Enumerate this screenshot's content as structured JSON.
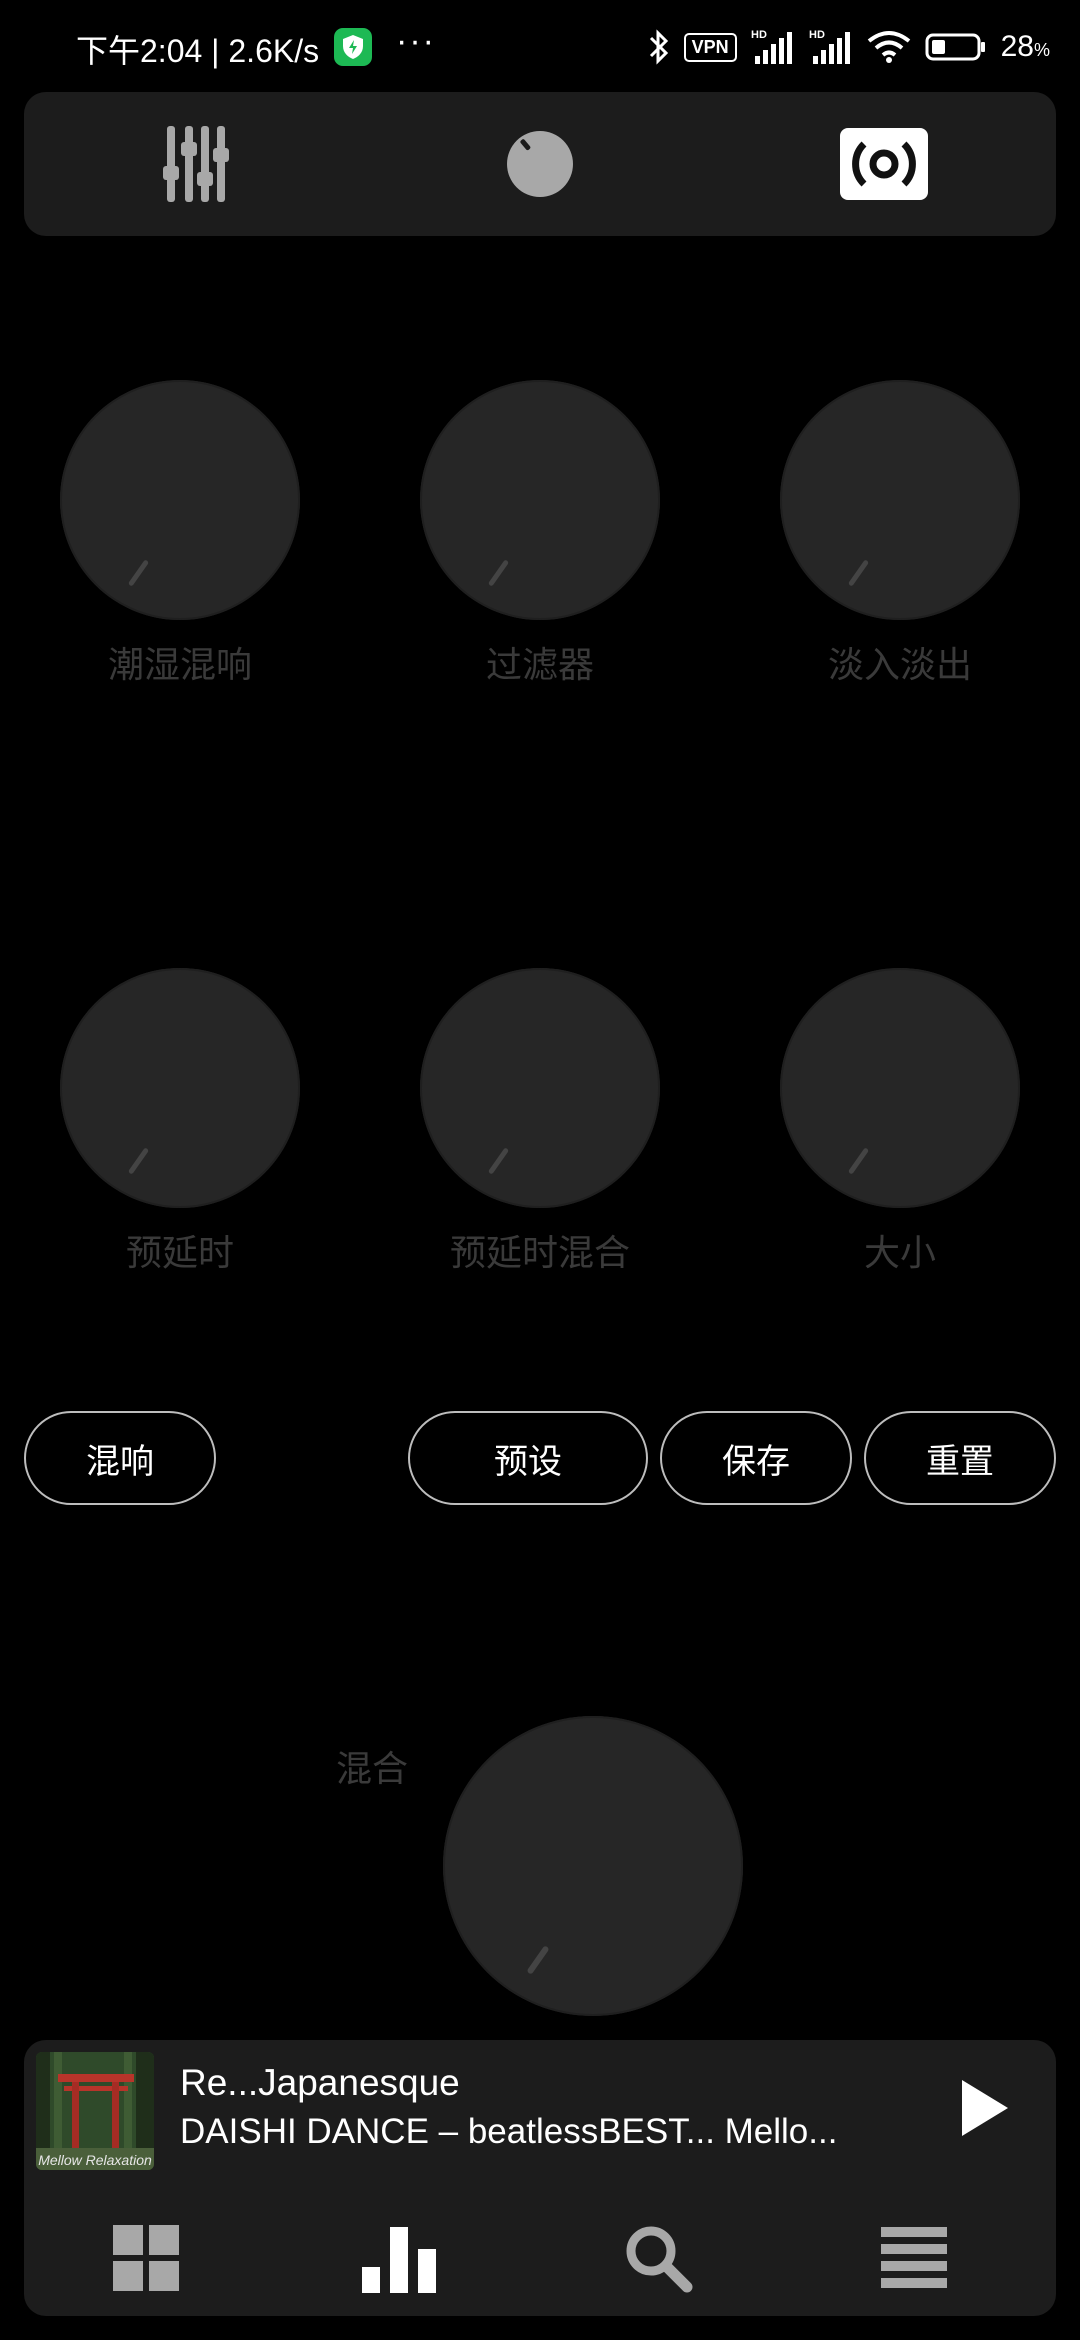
{
  "status_bar": {
    "time_speed": "下午2:04 | 2.6K/s",
    "more_dots": "···",
    "vpn": "VPN",
    "battery_pct": "28",
    "battery_unit": "%"
  },
  "tabs": [
    {
      "icon": "equalizer-sliders-icon"
    },
    {
      "icon": "knob-icon"
    },
    {
      "icon": "surround-icon",
      "active": true
    }
  ],
  "knobs_row1": [
    {
      "label": "潮湿混响"
    },
    {
      "label": "过滤器"
    },
    {
      "label": "淡入淡出"
    }
  ],
  "knobs_row2": [
    {
      "label": "预延时"
    },
    {
      "label": "预延时混合"
    },
    {
      "label": "大小"
    }
  ],
  "buttons": {
    "reverb": "混响",
    "preset": "预设",
    "save": "保存",
    "reset": "重置"
  },
  "mix": {
    "label": "混合"
  },
  "now_playing": {
    "title": "Re...Japanesque",
    "artist": "DAISHI DANCE – beatlessBEST... Mello...",
    "album_caption": "Mellow Relaxation"
  },
  "bottom_nav": [
    {
      "icon": "grid-icon"
    },
    {
      "icon": "bar-chart-icon"
    },
    {
      "icon": "search-icon"
    },
    {
      "icon": "menu-icon"
    }
  ],
  "colors": {
    "background": "#000000",
    "panel": "#1c1c1c",
    "knob": "#262626",
    "label_dim": "#3a3a3a",
    "accent_white": "#ffffff"
  }
}
